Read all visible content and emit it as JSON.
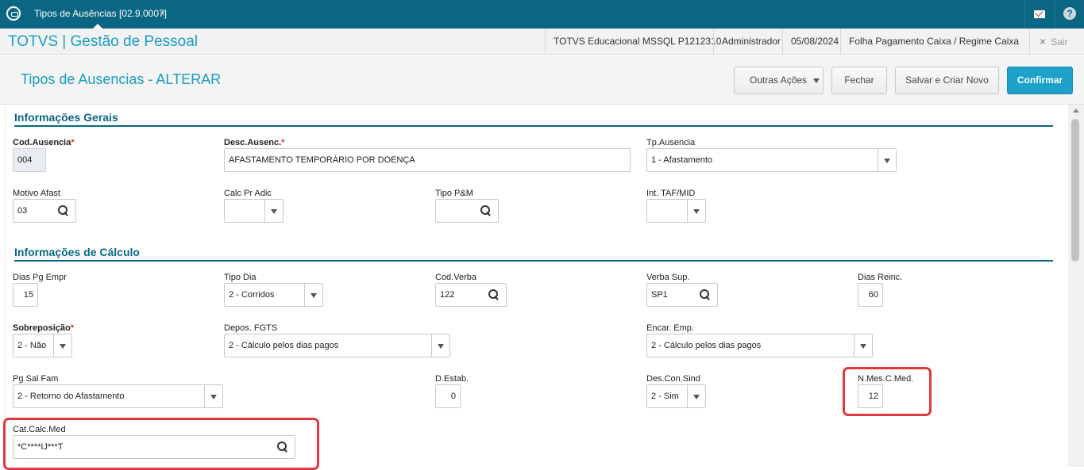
{
  "topbar": {
    "tab_label": "Tipos de Ausências [02.9.0007]",
    "tab_close": "×",
    "help": "?"
  },
  "header": {
    "app_title": "TOTVS | Gestão de Pessoal",
    "environment": "TOTVS Educacional MSSQL P1212310",
    "user": "Administrador",
    "date": "05/08/2024",
    "payroll": "Folha Pagamento Caixa / Regime Caixa",
    "exit_label": "Sair",
    "exit_icon": "×"
  },
  "pagebar": {
    "title": "Tipos de Ausencias - ALTERAR",
    "btn_outras": "Outras Ações",
    "btn_fechar": "Fechar",
    "btn_salvar": "Salvar e Criar Novo",
    "btn_confirmar": "Confirmar"
  },
  "sections": {
    "gerais": "Informações Gerais",
    "calculo": "Informações de Cálculo"
  },
  "fields": {
    "cod_ausencia": {
      "label": "Cod.Ausencia",
      "value": "004"
    },
    "desc_ausenc": {
      "label": "Desc.Ausenc.",
      "value": "AFASTAMENTO TEMPORÁRIO POR DOENÇA"
    },
    "tp_ausencia": {
      "label": "Tp.Ausencia",
      "value": "1 - Afastamento"
    },
    "motivo_afast": {
      "label": "Motivo Afast",
      "value": "03"
    },
    "calc_pr_adic": {
      "label": "Calc Pr Adic",
      "value": ""
    },
    "tipo_pm": {
      "label": "Tipo P&M",
      "value": ""
    },
    "int_taf_mid": {
      "label": "Int. TAF/MID",
      "value": ""
    },
    "dias_pg_empr": {
      "label": "Dias Pg Empr",
      "value": "15"
    },
    "tipo_dia": {
      "label": "Tipo Dia",
      "value": "2 - Corridos"
    },
    "cod_verba": {
      "label": "Cod.Verba",
      "value": "122"
    },
    "verba_sup": {
      "label": "Verba Sup.",
      "value": "SP1"
    },
    "dias_reinc": {
      "label": "Dias Reinc.",
      "value": "60"
    },
    "sobreposicao": {
      "label": "Sobreposição",
      "value": "2 - Não"
    },
    "depos_fgts": {
      "label": "Depos. FGTS",
      "value": "2 - Cálculo pelos dias pagos"
    },
    "encar_emp": {
      "label": "Encar. Emp.",
      "value": "2 - Cálculo pelos dias pagos"
    },
    "pg_sal_fam": {
      "label": "Pg Sal Fam",
      "value": "2 - Retorno do Afastamento"
    },
    "d_estab": {
      "label": "D.Estab.",
      "value": "0"
    },
    "des_con_sind": {
      "label": "Des.Con.Sind",
      "value": "2 - Sim"
    },
    "n_mes_c_med": {
      "label": "N.Mes.C.Med.",
      "value": "12"
    },
    "cat_calc_med": {
      "label": "Cat.Calc.Med",
      "value": "*C****IJ***T"
    }
  },
  "required_mark": "*",
  "colors": {
    "brand": "#0a6682",
    "accent": "#1a9cc4",
    "confirm": "#1da0c9",
    "highlight": "#e0383d",
    "required": "#d9302c"
  }
}
